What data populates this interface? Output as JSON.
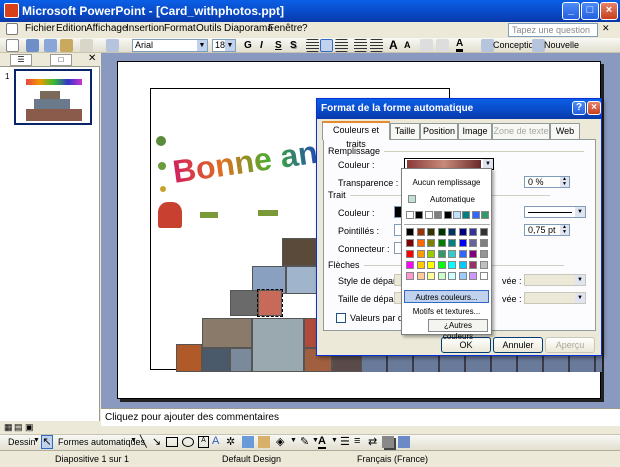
{
  "window": {
    "title": "Microsoft PowerPoint - [Card_withphotos.ppt]"
  },
  "menu": {
    "items": [
      "Fichier",
      "Edition",
      "Affichage",
      "Insertion",
      "Format",
      "Outils",
      "Diaporama",
      "Fenêtre",
      "?"
    ],
    "help_placeholder": "Tapez une question"
  },
  "toolbar": {
    "font": "Arial",
    "size": "18",
    "bold": "G",
    "italic": "I",
    "underline": "S",
    "shadow": "S",
    "conception": "Conception",
    "nouvelle_diapo": "Nouvelle diapositive"
  },
  "slide": {
    "number": "1",
    "greeting": "Bonne année"
  },
  "notes": {
    "placeholder": "Cliquez pour ajouter des commentaires"
  },
  "drawing": {
    "dessin": "Dessin",
    "formes": "Formes automatiques"
  },
  "status": {
    "slide": "Diapositive 1 sur 1",
    "design": "Default Design",
    "language": "Français (France)"
  },
  "dialog": {
    "title": "Format de la forme automatique",
    "tabs": [
      "Couleurs et traits",
      "Taille",
      "Position",
      "Image",
      "Zone de texte",
      "Web"
    ],
    "remplissage": "Remplissage",
    "couleur_label": "Couleur :",
    "transparence_label": "Transparence :",
    "transparence_value": "0 %",
    "trait": "Trait",
    "trait_couleur": "Couleur :",
    "pointilles": "Pointillés :",
    "epaisseur_value": "0,75 pt",
    "connecteur": "Connecteur :",
    "fleches": "Flèches",
    "style_depart": "Style de départ :",
    "taille_depart": "Taille de départ :",
    "arrivee1": "vée :",
    "arrivee2": "vée :",
    "valeurs_defaut": "Valeurs par défaut",
    "ok": "OK",
    "annuler": "Annuler",
    "apercu": "Aperçu"
  },
  "color_popup": {
    "aucun": "Aucun remplissage",
    "automatique": "Automatique",
    "autres_couleurs": "Autres couleurs...",
    "motifs": "Motifs et textures...",
    "autres_couleurs2": "¿Autres couleurs",
    "row1": [
      "#ffffff",
      "#000000",
      "#ffffff",
      "#808080",
      "#000000",
      "#c0e0ff",
      "#008080",
      "#3366ff",
      "#339966"
    ],
    "palette": [
      [
        "#000000",
        "#993300",
        "#333300",
        "#003300",
        "#003366",
        "#000080",
        "#333399",
        "#333333"
      ],
      [
        "#800000",
        "#ff6600",
        "#808000",
        "#008000",
        "#008080",
        "#0000ff",
        "#666699",
        "#808080"
      ],
      [
        "#ff0000",
        "#ff9900",
        "#99cc00",
        "#339966",
        "#33cccc",
        "#3366ff",
        "#800080",
        "#969696"
      ],
      [
        "#ff00ff",
        "#ffcc00",
        "#ffff00",
        "#00ff00",
        "#00ffff",
        "#00ccff",
        "#993366",
        "#c0c0c0"
      ],
      [
        "#ff99cc",
        "#ffcc99",
        "#ffff99",
        "#ccffcc",
        "#ccffff",
        "#99ccff",
        "#cc99ff",
        "#ffffff"
      ]
    ]
  }
}
